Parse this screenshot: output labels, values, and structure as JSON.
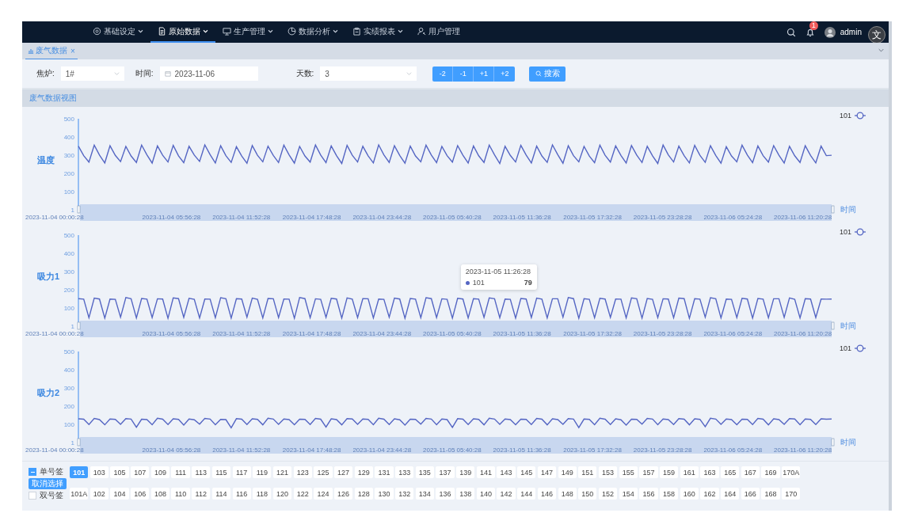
{
  "nav": {
    "items": [
      {
        "label": "基础设定",
        "has_menu": true,
        "selected": false
      },
      {
        "label": "原始数据",
        "has_menu": true,
        "selected": true
      },
      {
        "label": "生产管理",
        "has_menu": true,
        "selected": false
      },
      {
        "label": "数据分析",
        "has_menu": true,
        "selected": false
      },
      {
        "label": "实绩报表",
        "has_menu": true,
        "selected": false
      },
      {
        "label": "用户管理",
        "has_menu": false,
        "selected": false
      }
    ],
    "notification_count": "1",
    "user": "admin",
    "overlay_glyph": "文"
  },
  "page_tabs": [
    {
      "label": "废气数据",
      "close_glyph": "×",
      "selected": true
    }
  ],
  "filters": {
    "fields": [
      {
        "label": "焦炉:",
        "value": "1#",
        "kind": "select"
      },
      {
        "label": "时间:",
        "value": "2023-11-06",
        "kind": "date"
      },
      {
        "label": "天数:",
        "value": "3",
        "kind": "select"
      }
    ],
    "step_buttons": [
      "-2",
      "-1",
      "+1",
      "+2"
    ],
    "search_button": "搜索"
  },
  "section_title": "废气数据视图",
  "charts": [
    {
      "time_labels": [
        "2023-11-04 00:00:28",
        "2023-11-04 05:56:28",
        "2023-11-04 11:52:28",
        "2023-11-04 17:48:28",
        "2023-11-04 23:44:28",
        "2023-11-05 05:40:28",
        "2023-11-05 11:36:28",
        "2023-11-05 17:32:28",
        "2023-11-05 23:28:28",
        "2023-11-06 05:24:28",
        "2023-11-06 11:20:28"
      ],
      "chart_data": {
        "type": "line",
        "ylabel": "温度",
        "xlabel": "时间",
        "ylim": [
          1,
          500
        ],
        "yticks": [
          1,
          100,
          200,
          300,
          400,
          500
        ],
        "series": [
          {
            "name": "101",
            "color": "#5566c3",
            "values": [
              350,
              298,
              262,
              355,
              301,
              258,
              352,
              299,
              265,
              348,
              296,
              260,
              356,
              302,
              257,
              351,
              300,
              263,
              354,
              297,
              259,
              349,
              301,
              266,
              357,
              303,
              258,
              352,
              298,
              261,
              347,
              295,
              256,
              353,
              300,
              264,
              350,
              299,
              260,
              355,
              302,
              257,
              348,
              296,
              262,
              356,
              301,
              259,
              351,
              298,
              255,
              354,
              300,
              263,
              349,
              297,
              258,
              357,
              302,
              261,
              352,
              299,
              256,
              350,
              296,
              264,
              355,
              301,
              259,
              348,
              298,
              262,
              353,
              300,
              257,
              351,
              297,
              260,
              356,
              302,
              255,
              349,
              299,
              263,
              354,
              301,
              258,
              350,
              296,
              261,
              357,
              303,
              256,
              352,
              298,
              264,
              348,
              295,
              259,
              355,
              300,
              262,
              351,
              299,
              257,
              353,
              301,
              260,
              349,
              297,
              255,
              356,
              302,
              263,
              350,
              298,
              258,
              354,
              300,
              261,
              352,
              299,
              256,
              347,
              296,
              264,
              355,
              301,
              259,
              351,
              298,
              262,
              353,
              300,
              257,
              349,
              297,
              260,
              352,
              299,
              258,
              350,
              298,
              300
            ]
          }
        ]
      }
    },
    {
      "time_labels": [
        "2023-11-04 00:00:28",
        "2023-11-04 05:56:28",
        "2023-11-04 11:52:28",
        "2023-11-04 17:48:28",
        "2023-11-04 23:44:28",
        "2023-11-05 05:40:28",
        "2023-11-05 11:36:28",
        "2023-11-05 17:32:28",
        "2023-11-05 23:28:28",
        "2023-11-06 05:24:28",
        "2023-11-06 11:20:28"
      ],
      "chart_data": {
        "type": "line",
        "ylabel": "吸力1",
        "xlabel": "时间",
        "ylim": [
          1,
          500
        ],
        "yticks": [
          1,
          100,
          200,
          300,
          400,
          500
        ],
        "series": [
          {
            "name": "101",
            "color": "#5566c3",
            "values": [
              152,
              149,
              47,
              155,
              150,
              45,
              150,
              148,
              50,
              158,
              151,
              46,
              153,
              149,
              48,
              151,
              150,
              44,
              156,
              152,
              49,
              154,
              148,
              46,
              150,
              149,
              47,
              157,
              151,
              45,
              152,
              150,
              50,
              155,
              148,
              46,
              153,
              151,
              48,
              150,
              149,
              44,
              158,
              152,
              47,
              151,
              148,
              49,
              154,
              150,
              45,
              156,
              149,
              48,
              152,
              151,
              46,
              150,
              148,
              50,
              155,
              150,
              44,
              153,
              149,
              47,
              157,
              152,
              48,
              151,
              148,
              45,
              154,
              150,
              46,
              152,
              149,
              49,
              156,
              151,
              47,
              150,
              148,
              45,
              153,
              150,
              48,
              155,
              149,
              46,
              151,
              151,
              50,
              158,
              152,
              44,
              152,
              148,
              47,
              154,
              150,
              49,
              150,
              149,
              46,
              156,
              151,
              45,
              153,
              148,
              48,
              151,
              150,
              47,
              155,
              152,
              44,
              152,
              149,
              50,
              157,
              151,
              46,
              150,
              148,
              48,
              154,
              150,
              45,
              153,
              149,
              47,
              151,
              151,
              49,
              156,
              148,
              46,
              152,
              150,
              48,
              150,
              149,
              150
            ]
          }
        ]
      },
      "tooltip": {
        "time": "2023-11-05 11:26:28",
        "series": "101",
        "value": "79"
      }
    },
    {
      "time_labels": [
        "2023-11-04 00:00:28",
        "2023-11-04 05:56:28",
        "2023-11-04 11:52:28",
        "2023-11-04 17:48:28",
        "2023-11-04 23:44:28",
        "2023-11-05 05:40:28",
        "2023-11-05 11:36:28",
        "2023-11-05 17:32:28",
        "2023-11-05 23:28:28",
        "2023-11-06 05:24:28",
        "2023-11-06 11:20:28"
      ],
      "chart_data": {
        "type": "line",
        "ylabel": "吸力2",
        "xlabel": "时间",
        "ylim": [
          1,
          500
        ],
        "yticks": [
          1,
          100,
          200,
          300,
          400,
          500
        ],
        "series": [
          {
            "name": "101",
            "color": "#5566c3",
            "values": [
              131,
              129,
              100,
              133,
              127,
              98,
              130,
              128,
              101,
              132,
              130,
              85,
              129,
              127,
              99,
              134,
              129,
              100,
              131,
              128,
              97,
              130,
              126,
              102,
              133,
              130,
              99,
              128,
              127,
              82,
              132,
              129,
              100,
              131,
              128,
              98,
              134,
              130,
              101,
              130,
              127,
              99,
              129,
              128,
              100,
              133,
              129,
              86,
              131,
              127,
              98,
              132,
              130,
              101,
              130,
              128,
              99,
              134,
              129,
              100,
              131,
              126,
              97,
              129,
              128,
              102,
              133,
              130,
              99,
              130,
              127,
              84,
              132,
              129,
              100,
              131,
              128,
              98,
              134,
              130,
              101,
              130,
              127,
              99,
              129,
              128,
              100,
              133,
              129,
              98,
              131,
              127,
              101,
              132,
              130,
              83,
              130,
              128,
              99,
              134,
              129,
              100,
              131,
              126,
              97,
              129,
              128,
              102,
              133,
              130,
              99,
              130,
              127,
              100,
              132,
              129,
              98,
              131,
              128,
              88,
              134,
              130,
              101,
              130,
              127,
              99,
              129,
              128,
              100,
              133,
              129,
              98,
              131,
              127,
              101,
              132,
              130,
              99,
              130,
              128,
              100,
              131,
              129,
              130
            ]
          }
        ]
      }
    }
  ],
  "tag_groups": [
    {
      "label": "单号签",
      "checked": true,
      "tags": [
        {
          "label": "101",
          "selected": true
        },
        {
          "label": "103",
          "selected": false
        },
        {
          "label": "105",
          "selected": false
        },
        {
          "label": "107",
          "selected": false
        },
        {
          "label": "109",
          "selected": false
        },
        {
          "label": "111",
          "selected": false
        },
        {
          "label": "113",
          "selected": false
        },
        {
          "label": "115",
          "selected": false
        },
        {
          "label": "117",
          "selected": false
        },
        {
          "label": "119",
          "selected": false
        },
        {
          "label": "121",
          "selected": false
        },
        {
          "label": "123",
          "selected": false
        },
        {
          "label": "125",
          "selected": false
        },
        {
          "label": "127",
          "selected": false
        },
        {
          "label": "129",
          "selected": false
        },
        {
          "label": "131",
          "selected": false
        },
        {
          "label": "133",
          "selected": false
        },
        {
          "label": "135",
          "selected": false
        },
        {
          "label": "137",
          "selected": false
        },
        {
          "label": "139",
          "selected": false
        },
        {
          "label": "141",
          "selected": false
        },
        {
          "label": "143",
          "selected": false
        },
        {
          "label": "145",
          "selected": false
        },
        {
          "label": "147",
          "selected": false
        },
        {
          "label": "149",
          "selected": false
        },
        {
          "label": "151",
          "selected": false
        },
        {
          "label": "153",
          "selected": false
        },
        {
          "label": "155",
          "selected": false
        },
        {
          "label": "157",
          "selected": false
        },
        {
          "label": "159",
          "selected": false
        },
        {
          "label": "161",
          "selected": false
        },
        {
          "label": "163",
          "selected": false
        },
        {
          "label": "165",
          "selected": false
        },
        {
          "label": "167",
          "selected": false
        },
        {
          "label": "169",
          "selected": false
        },
        {
          "label": "170A",
          "selected": false
        }
      ]
    },
    {
      "label": "双号签",
      "checked": false,
      "tags": [
        {
          "label": "101A",
          "selected": false
        },
        {
          "label": "102",
          "selected": false
        },
        {
          "label": "104",
          "selected": false
        },
        {
          "label": "106",
          "selected": false
        },
        {
          "label": "108",
          "selected": false
        },
        {
          "label": "110",
          "selected": false
        },
        {
          "label": "112",
          "selected": false
        },
        {
          "label": "114",
          "selected": false
        },
        {
          "label": "116",
          "selected": false
        },
        {
          "label": "118",
          "selected": false
        },
        {
          "label": "120",
          "selected": false
        },
        {
          "label": "122",
          "selected": false
        },
        {
          "label": "124",
          "selected": false
        },
        {
          "label": "126",
          "selected": false
        },
        {
          "label": "128",
          "selected": false
        },
        {
          "label": "130",
          "selected": false
        },
        {
          "label": "132",
          "selected": false
        },
        {
          "label": "134",
          "selected": false
        },
        {
          "label": "136",
          "selected": false
        },
        {
          "label": "138",
          "selected": false
        },
        {
          "label": "140",
          "selected": false
        },
        {
          "label": "142",
          "selected": false
        },
        {
          "label": "144",
          "selected": false
        },
        {
          "label": "146",
          "selected": false
        },
        {
          "label": "148",
          "selected": false
        },
        {
          "label": "150",
          "selected": false
        },
        {
          "label": "152",
          "selected": false
        },
        {
          "label": "154",
          "selected": false
        },
        {
          "label": "156",
          "selected": false
        },
        {
          "label": "158",
          "selected": false
        },
        {
          "label": "160",
          "selected": false
        },
        {
          "label": "162",
          "selected": false
        },
        {
          "label": "164",
          "selected": false
        },
        {
          "label": "166",
          "selected": false
        },
        {
          "label": "168",
          "selected": false
        },
        {
          "label": "170",
          "selected": false
        }
      ]
    }
  ],
  "clear_button": "取消选择"
}
